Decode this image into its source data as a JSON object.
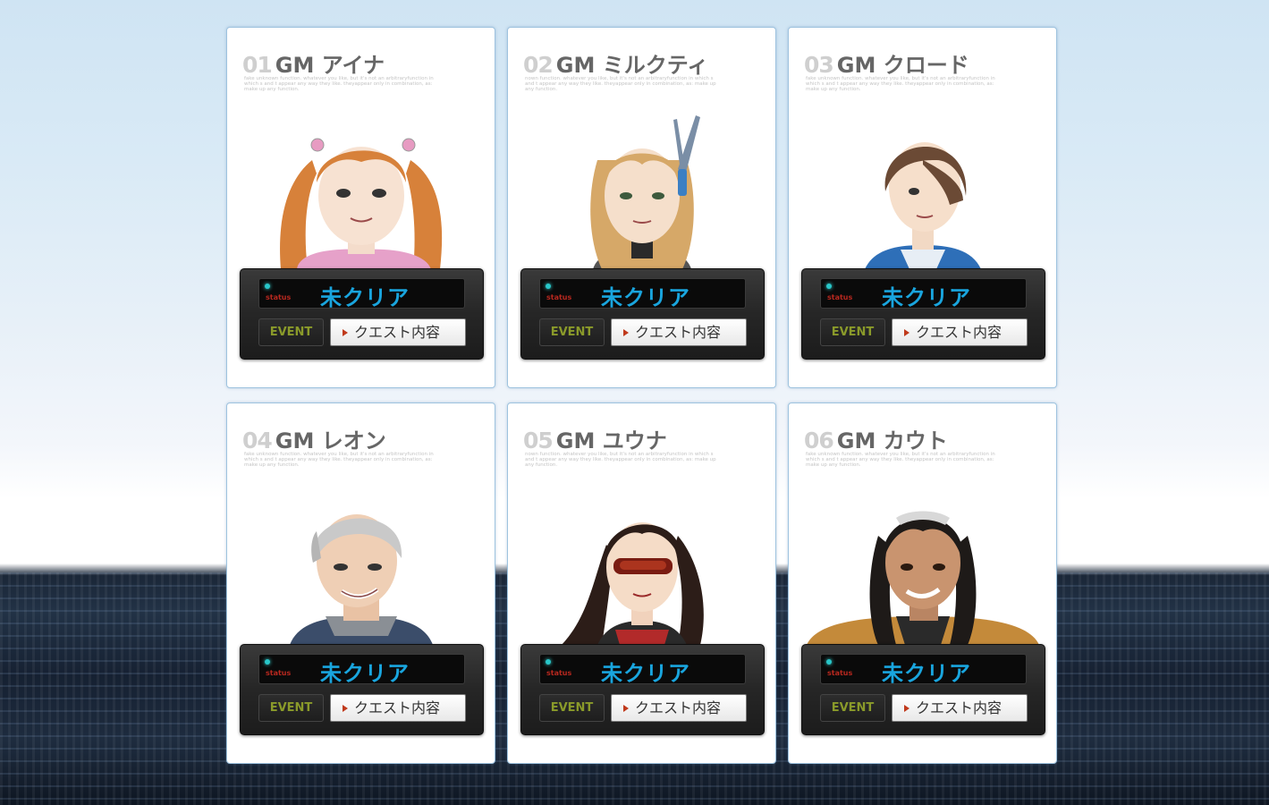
{
  "cards": [
    {
      "number": "01",
      "name": "GM アイナ",
      "blurb": "fake unknown function. whatever you like, but it's not an arbitraryfunction in which s and t appear any way they like. theyappear only in combination, as: make up any function.",
      "status_label": "status",
      "status_value": "未クリア",
      "event_label": "EVENT",
      "quest_label": "クエスト内容"
    },
    {
      "number": "02",
      "name": "GM ミルクティ",
      "blurb": "nown function. whatever you like, but it's not an arbitraryfunction in which s and t appear any way they like. theyappear only in combination, as: make up any function.",
      "status_label": "status",
      "status_value": "未クリア",
      "event_label": "EVENT",
      "quest_label": "クエスト内容"
    },
    {
      "number": "03",
      "name": "GM クロード",
      "blurb": "fake unknown function. whatever you like, but it's not an arbitraryfunction in which s and t appear any way they like. theyappear only in combination, as: make up any function.",
      "status_label": "status",
      "status_value": "未クリア",
      "event_label": "EVENT",
      "quest_label": "クエスト内容"
    },
    {
      "number": "04",
      "name": "GM レオン",
      "blurb": "fake unknown function. whatever you like, but it's not an arbitraryfunction in which s and t appear any way they like. theyappear only in combination, as: make up any function.",
      "status_label": "status",
      "status_value": "未クリア",
      "event_label": "EVENT",
      "quest_label": "クエスト内容"
    },
    {
      "number": "05",
      "name": "GM ユウナ",
      "blurb": "nown function. whatever you like, but it's not an arbitraryfunction in which s and t appear any way they like. theyappear only in combination, as: make up any function.",
      "status_label": "status",
      "status_value": "未クリア",
      "event_label": "EVENT",
      "quest_label": "クエスト内容"
    },
    {
      "number": "06",
      "name": "GM カウト",
      "blurb": "fake unknown function. whatever you like, but it's not an arbitraryfunction in which s and t appear any way they like. theyappear only in combination, as: make up any function.",
      "status_label": "status",
      "status_value": "未クリア",
      "event_label": "EVENT",
      "quest_label": "クエスト内容"
    }
  ],
  "colors": {
    "status_text": "#19a5de",
    "status_led": "#28c6c9",
    "event_text": "#8a9a2a",
    "number_gray": "#cfcfcf",
    "card_border": "#9ec3df"
  }
}
